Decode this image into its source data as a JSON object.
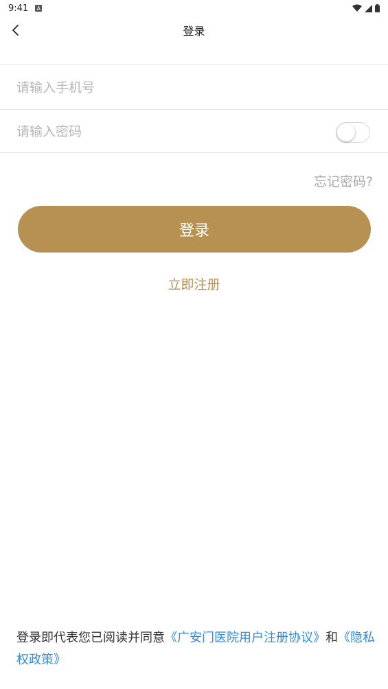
{
  "status_bar": {
    "time": "9:41",
    "a_glyph": "A"
  },
  "nav": {
    "title": "登录",
    "back_icon": "chevron-left-icon"
  },
  "form": {
    "phone_placeholder": "请输入手机号",
    "phone_value": "",
    "password_placeholder": "请输入密码",
    "password_value": "",
    "show_password_toggle": false
  },
  "forgot_password": "忘记密码?",
  "login_button": "登录",
  "register_link": "立即注册",
  "agreement": {
    "prefix": "登录即代表您已阅读并同意",
    "user_agreement": "《广安门医院用户注册协议》",
    "conjunction": "和",
    "privacy_policy": "《隐私权政策》"
  },
  "colors": {
    "accent": "#b69152",
    "link": "#2f8be6",
    "text": "#333333",
    "placeholder": "#b8b8b8",
    "divider": "#e6e6e6"
  }
}
